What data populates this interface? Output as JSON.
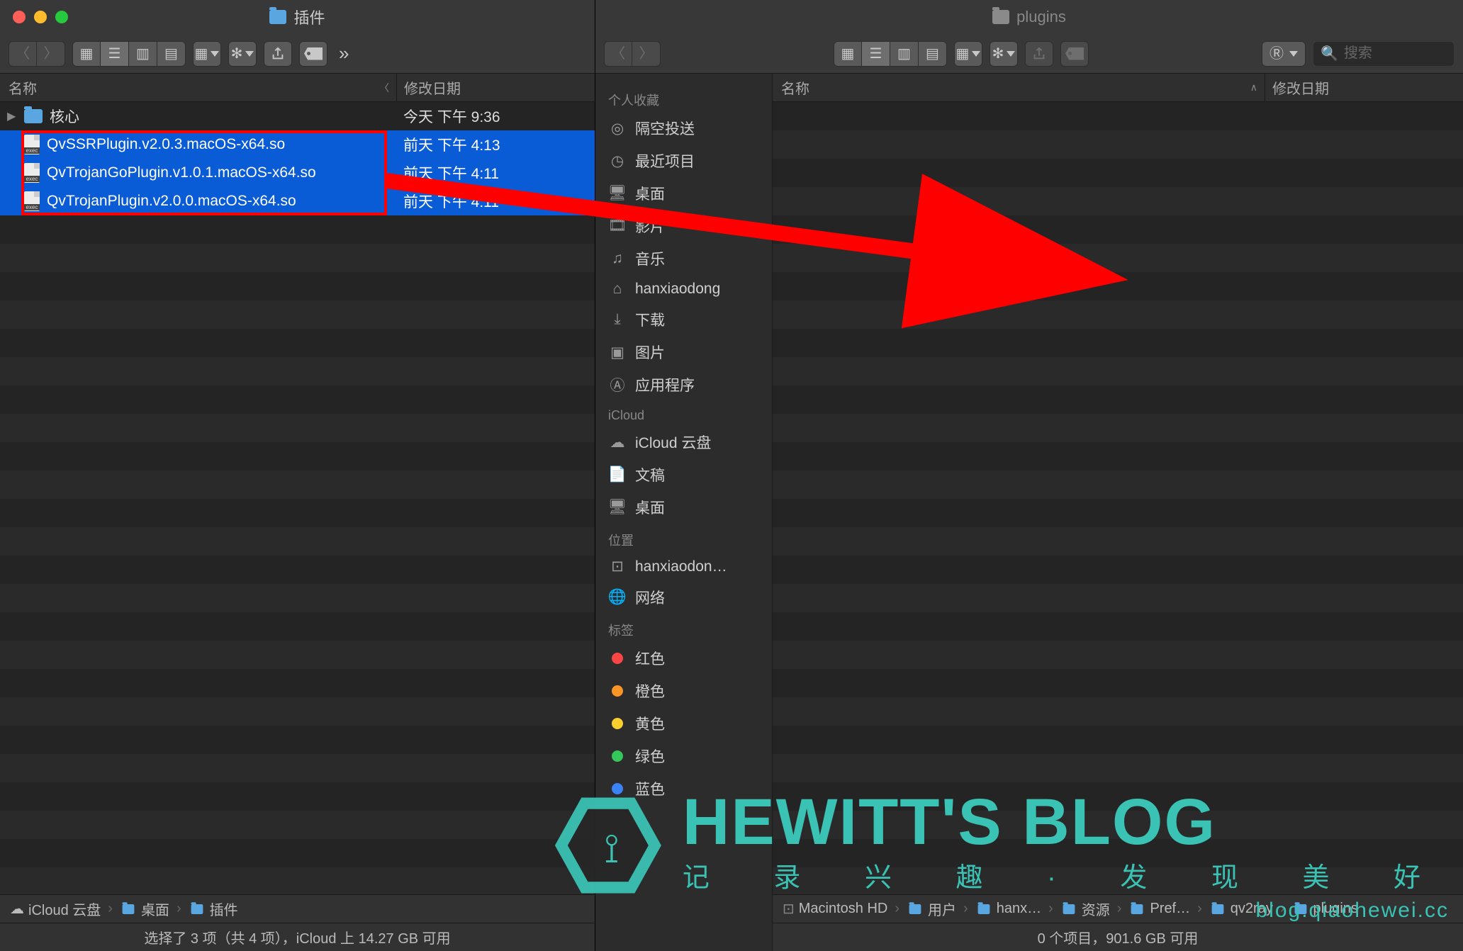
{
  "left_window": {
    "title": "插件",
    "columns": {
      "name": "名称",
      "date": "修改日期"
    },
    "rows": [
      {
        "type": "folder",
        "name": "核心",
        "date": "今天 下午 9:36",
        "selected": false
      },
      {
        "type": "file",
        "name": "QvSSRPlugin.v2.0.3.macOS-x64.so",
        "date": "前天 下午 4:13",
        "selected": true
      },
      {
        "type": "file",
        "name": "QvTrojanGoPlugin.v1.0.1.macOS-x64.so",
        "date": "前天 下午 4:11",
        "selected": true
      },
      {
        "type": "file",
        "name": "QvTrojanPlugin.v2.0.0.macOS-x64.so",
        "date": "前天 下午 4:11",
        "selected": true
      }
    ],
    "path": [
      "iCloud 云盘",
      "桌面",
      "插件"
    ],
    "status": "选择了 3 项（共 4 项），iCloud 上 14.27 GB 可用"
  },
  "right_window": {
    "title": "plugins",
    "search_placeholder": "搜索",
    "columns": {
      "name": "名称",
      "date": "修改日期"
    },
    "sidebar": {
      "favorites_label": "个人收藏",
      "favorites": [
        {
          "icon": "airdrop",
          "label": "隔空投送"
        },
        {
          "icon": "clock",
          "label": "最近项目"
        },
        {
          "icon": "desktop",
          "label": "桌面"
        },
        {
          "icon": "movie",
          "label": "影片"
        },
        {
          "icon": "music",
          "label": "音乐"
        },
        {
          "icon": "home",
          "label": "hanxiaodong"
        },
        {
          "icon": "download",
          "label": "下载"
        },
        {
          "icon": "picture",
          "label": "图片"
        },
        {
          "icon": "app",
          "label": "应用程序"
        }
      ],
      "icloud_label": "iCloud",
      "icloud": [
        {
          "icon": "cloud",
          "label": "iCloud 云盘"
        },
        {
          "icon": "doc",
          "label": "文稿"
        },
        {
          "icon": "desktop",
          "label": "桌面"
        }
      ],
      "locations_label": "位置",
      "locations": [
        {
          "icon": "disk",
          "label": "hanxiaodon…"
        },
        {
          "icon": "globe",
          "label": "网络"
        }
      ],
      "tags_label": "标签",
      "tags": [
        {
          "color": "#fc4545",
          "label": "红色"
        },
        {
          "color": "#fd9426",
          "label": "橙色"
        },
        {
          "color": "#fdcf2e",
          "label": "黄色"
        },
        {
          "color": "#35c759",
          "label": "绿色"
        },
        {
          "color": "#3a82f7",
          "label": "蓝色"
        }
      ]
    },
    "path": [
      "Macintosh HD",
      "用户",
      "hanx…",
      "资源",
      "Pref…",
      "qv2ray",
      "plugins"
    ],
    "status": "0 个项目，901.6 GB 可用"
  },
  "watermark": {
    "title": "HEWITT'S BLOG",
    "subtitle": "记 录 兴 趣 · 发 现 美 好",
    "url": "blog.qiaohewei.cc"
  }
}
